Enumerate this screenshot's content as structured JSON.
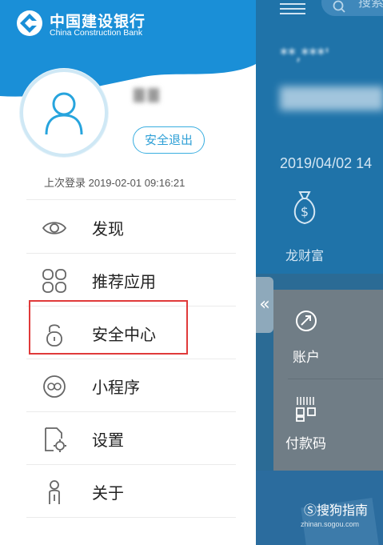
{
  "bank": {
    "name_cn": "中国建设银行",
    "name_en": "China Construction Bank"
  },
  "user": {
    "logout_label": "安全退出",
    "last_login": "上次登录  2019-02-01 09:16:21"
  },
  "menu": [
    {
      "label": "发现",
      "icon": "eye-icon"
    },
    {
      "label": "推荐应用",
      "icon": "apps-grid-icon"
    },
    {
      "label": "安全中心",
      "icon": "lock-icon"
    },
    {
      "label": "小程序",
      "icon": "mini-program-icon"
    },
    {
      "label": "设置",
      "icon": "settings-document-icon"
    },
    {
      "label": "关于",
      "icon": "person-info-icon"
    }
  ],
  "background_app": {
    "search_placeholder": "搜索",
    "masked_text": "**,***'",
    "date": "2019/04/02 14",
    "wealth_label": "龙财富",
    "account_label": "账户",
    "pay_code_label": "付款码"
  },
  "watermark": {
    "text": "搜狗指南",
    "url": "zhinan.sogou.com"
  },
  "colors": {
    "brand_blue": "#1a8fd7",
    "highlight_red": "#e03a3a",
    "logout_blue": "#2d9fd6",
    "icon_gray": "#666666"
  }
}
